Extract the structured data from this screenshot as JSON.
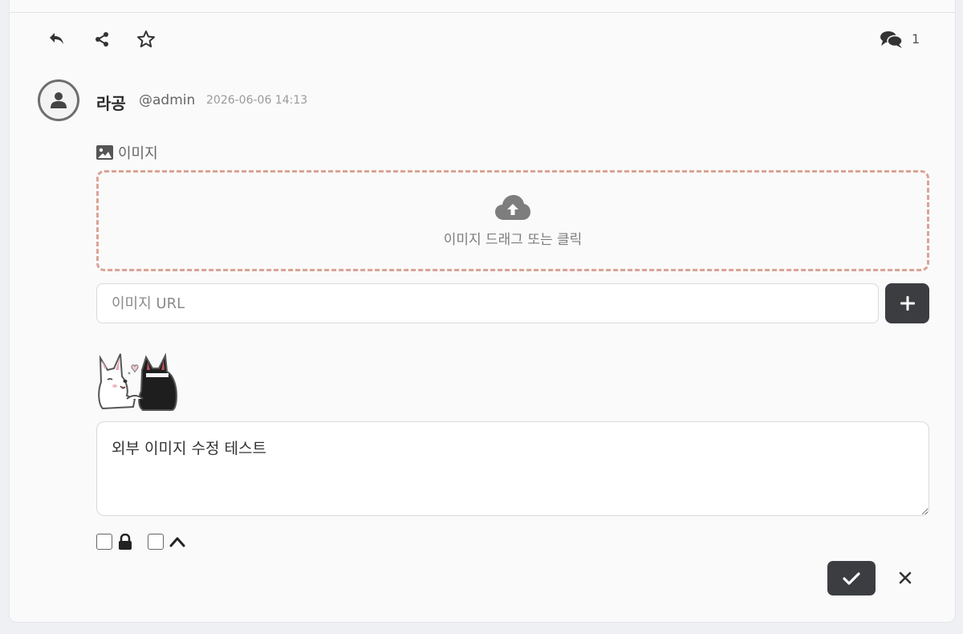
{
  "actions": {
    "icons": [
      "reply-icon",
      "share-icon",
      "star-icon",
      "comments-icon"
    ],
    "comment_count": "1"
  },
  "author": {
    "name": "라공",
    "handle": "@admin",
    "timestamp": "2026-06-06 14:13"
  },
  "image_section": {
    "label": "이미지",
    "dropzone_text": "이미지 드래그 또는 클릭",
    "url_placeholder": "이미지 URL",
    "url_value": ""
  },
  "editor": {
    "text": "외부 이미지 수정 테스트"
  },
  "options": {
    "private_checked": false,
    "pin_checked": false
  },
  "colors": {
    "dark_button": "#3b3d41",
    "dropzone_border": "#dba395",
    "card_bg": "#fafafa"
  }
}
